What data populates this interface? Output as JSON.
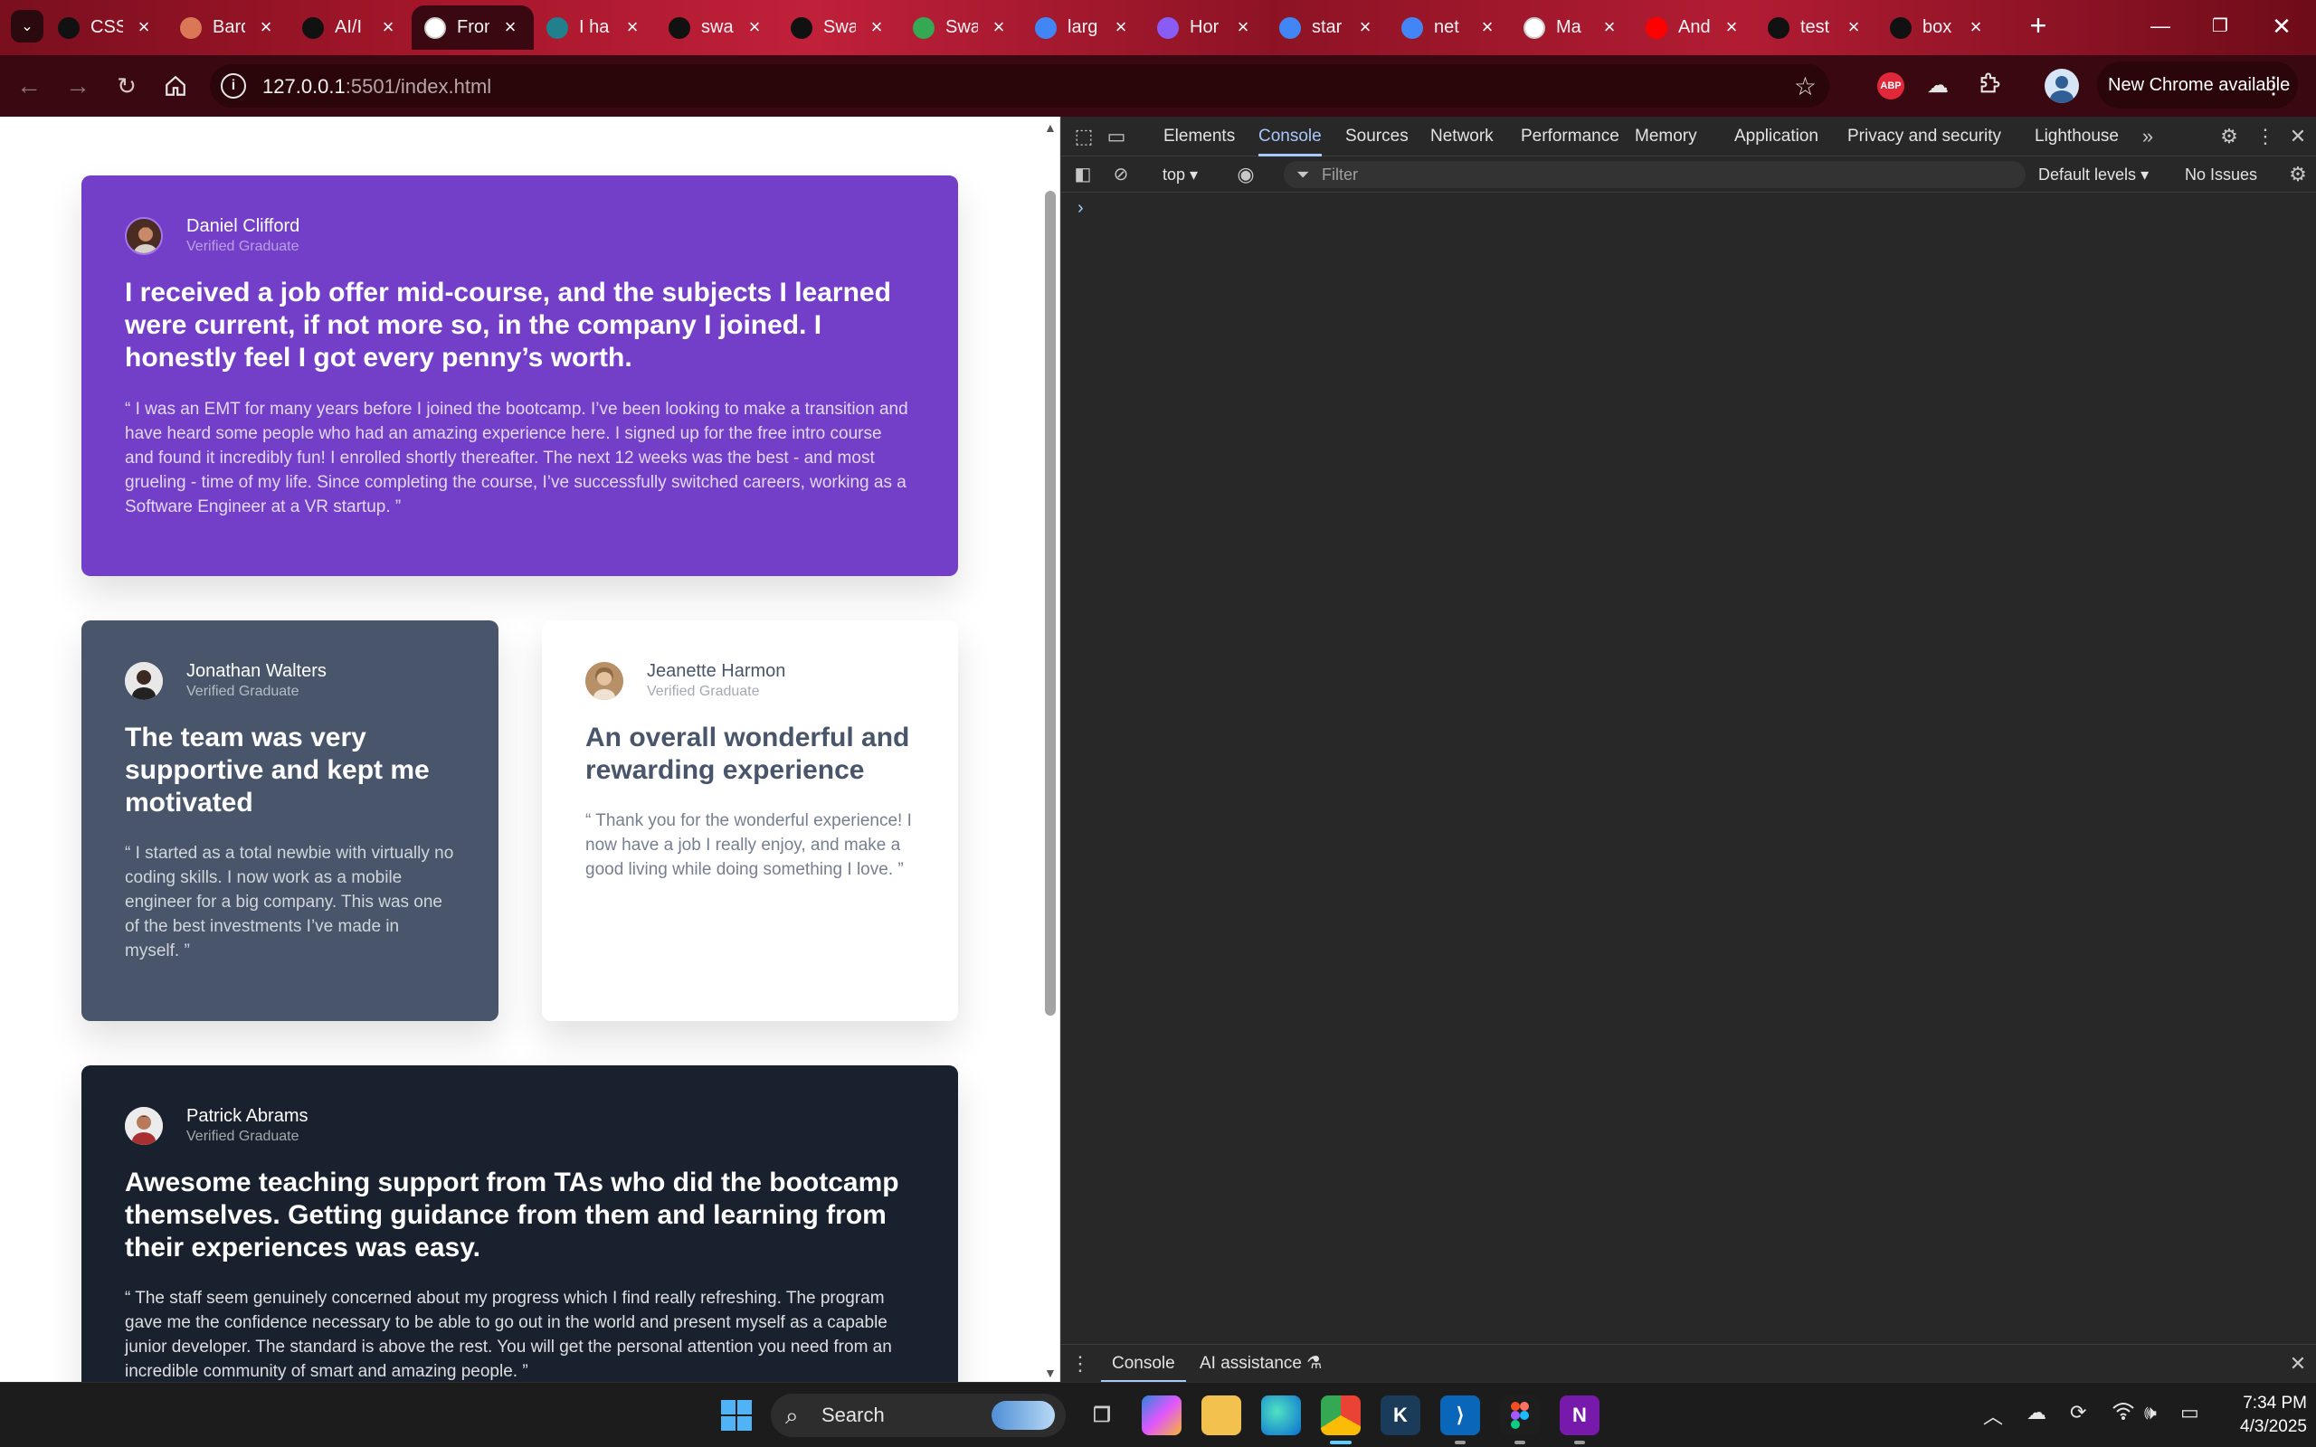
{
  "browser": {
    "tabs": [
      {
        "title": "CSS",
        "icon": "openai-icon",
        "color": "#111111"
      },
      {
        "title": "Bard",
        "icon": "claude-icon",
        "color": "#d97757"
      },
      {
        "title": "AI/I",
        "icon": "openai-icon",
        "color": "#111111"
      },
      {
        "title": "Fron",
        "icon": "frontend-mentor-icon",
        "color": "#ffffff",
        "active": true
      },
      {
        "title": "I ha",
        "icon": "perplexity-icon",
        "color": "#20808d"
      },
      {
        "title": "swa",
        "icon": "github-icon",
        "color": "#111111"
      },
      {
        "title": "Swa",
        "icon": "code-icon",
        "color": "#111111"
      },
      {
        "title": "Swa",
        "icon": "google-drive-icon",
        "color": "#34a853"
      },
      {
        "title": "larg",
        "icon": "google-icon",
        "color": "#4285f4"
      },
      {
        "title": "Hor",
        "icon": "copilot-icon",
        "color": "#8a5cf6"
      },
      {
        "title": "star",
        "icon": "google-icon",
        "color": "#4285f4"
      },
      {
        "title": "net",
        "icon": "google-icon",
        "color": "#4285f4"
      },
      {
        "title": "Ma",
        "icon": "notion-icon",
        "color": "#ffffff"
      },
      {
        "title": "And",
        "icon": "youtube-icon",
        "color": "#ff0000"
      },
      {
        "title": "test",
        "icon": "github-icon",
        "color": "#111111"
      },
      {
        "title": "box",
        "icon": "medium-icon",
        "color": "#111111"
      }
    ],
    "url_host": "127.0.0.1",
    "url_rest": ":5501/index.html",
    "abp_label": "ABP",
    "update_label": "New Chrome available"
  },
  "page": {
    "cards": [
      {
        "name": "Daniel Clifford",
        "role": "Verified Graduate",
        "headline": "I received a job offer mid-course, and the subjects I learned were current, if not more so, in the company I joined. I honestly feel I got every penny’s worth.",
        "quote": "“ I was an EMT for many years before I joined the bootcamp. I’ve been looking to make a transition and have heard some people who had an amazing experience here. I signed up for the free intro course and found it incredibly fun! I enrolled shortly thereafter. The next 12 weeks was the best - and most grueling - time of my life. Since completing the course, I’ve successfully switched careers, working as a Software Engineer at a VR startup. ”"
      },
      {
        "name": "Jonathan Walters",
        "role": "Verified Graduate",
        "headline": "The team was very supportive and kept me motivated",
        "quote": "“ I started as a total newbie with virtually no coding skills. I now work as a mobile engineer for a big company. This was one of the best investments I’ve made in myself. ”"
      },
      {
        "name": "Jeanette Harmon",
        "role": "Verified Graduate",
        "headline": "An overall wonderful and rewarding experience",
        "quote": "“ Thank you for the wonderful experience! I now have a job I really enjoy, and make a good living while doing something I love. ”"
      },
      {
        "name": "Patrick Abrams",
        "role": "Verified Graduate",
        "headline": "Awesome teaching support from TAs who did the bootcamp themselves. Getting guidance from them and learning from their experiences was easy.",
        "quote": "“ The staff seem genuinely concerned about my progress which I find really refreshing. The program gave me the confidence necessary to be able to go out in the world and present myself as a capable junior developer. The standard is above the rest. You will get the personal attention you need from an incredible community of smart and amazing people. ”"
      }
    ]
  },
  "devtools": {
    "tabs": [
      "Elements",
      "Console",
      "Sources",
      "Network",
      "Performance",
      "Memory",
      "Application",
      "Privacy and security",
      "Lighthouse"
    ],
    "active_tab": "Console",
    "context": "top",
    "filter_placeholder": "Filter",
    "levels": "Default levels",
    "issues": "No Issues",
    "prompt": "›",
    "drawer_tabs": [
      "Console",
      "AI assistance"
    ]
  },
  "taskbar": {
    "search_placeholder": "Search",
    "time": "7:34 PM",
    "date": "4/3/2025"
  },
  "colors": {
    "card1": "#733fc8",
    "card2": "#48556a",
    "card3": "#ffffff",
    "card4": "#19212e",
    "devtools_accent": "#a8c7fa"
  }
}
